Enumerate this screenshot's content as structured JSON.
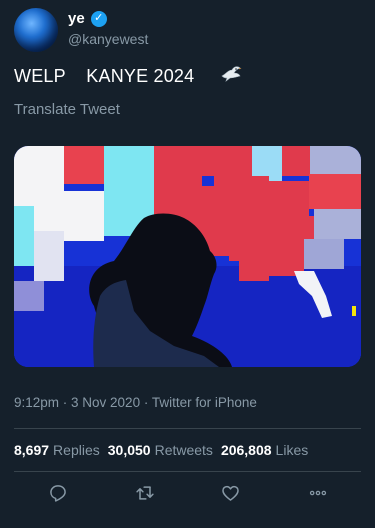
{
  "user": {
    "display_name": "ye",
    "handle": "@kanyewest",
    "verified": true
  },
  "tweet": {
    "text": "WELP    KANYE 2024",
    "emoji_icon": "dove-icon",
    "translate_label": "Translate Tweet",
    "timestamp": "9:12pm · 3 Nov 2020 · Twitter for iPhone"
  },
  "stats": {
    "replies_count": "8,697",
    "replies_label": "Replies",
    "retweets_count": "30,050",
    "retweets_label": "Retweets",
    "likes_count": "206,808",
    "likes_label": "Likes"
  },
  "actions": [
    "reply-icon",
    "retweet-icon",
    "like-icon",
    "more-icon"
  ],
  "colors": {
    "background": "#15202b",
    "secondary_text": "#8899a6",
    "verified": "#1da1f2",
    "divider": "#38444d"
  }
}
